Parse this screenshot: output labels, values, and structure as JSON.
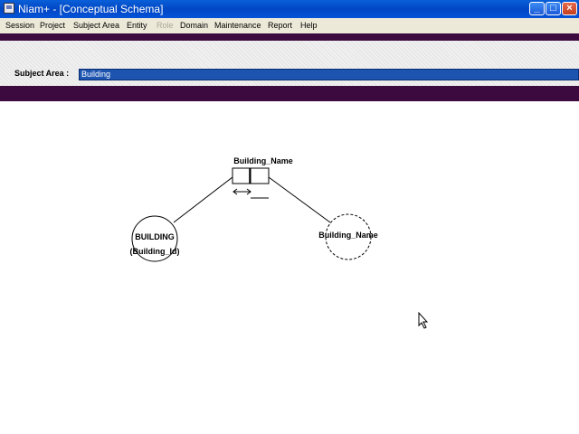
{
  "window": {
    "title": "Niam+ - [Conceptual Schema]",
    "minimize_glyph": "_",
    "maximize_glyph": "□",
    "close_glyph": "×"
  },
  "menu": {
    "items": [
      "Session",
      "Project",
      "Subject Area",
      "Entity",
      "Role",
      "Domain",
      "Maintenance",
      "Report",
      "Help"
    ],
    "disabled": [
      "Role"
    ]
  },
  "subject_area": {
    "label": "Subject Area :",
    "value": "Building"
  },
  "diagram": {
    "entity": {
      "name": "BUILDING",
      "identifier": "(Building_Id)"
    },
    "fact_type": {
      "name": "Building_Name"
    },
    "value_type": {
      "name": "Building_Name"
    }
  },
  "colors": {
    "title_bar": "#0047c4",
    "menu_bar": "#ece9d8",
    "purple_band": "#3d0a3f",
    "subject_field": "#1d54b0"
  },
  "icons": [
    "app-icon",
    "minimize-icon",
    "maximize-icon",
    "close-icon",
    "mouse-cursor-icon"
  ]
}
